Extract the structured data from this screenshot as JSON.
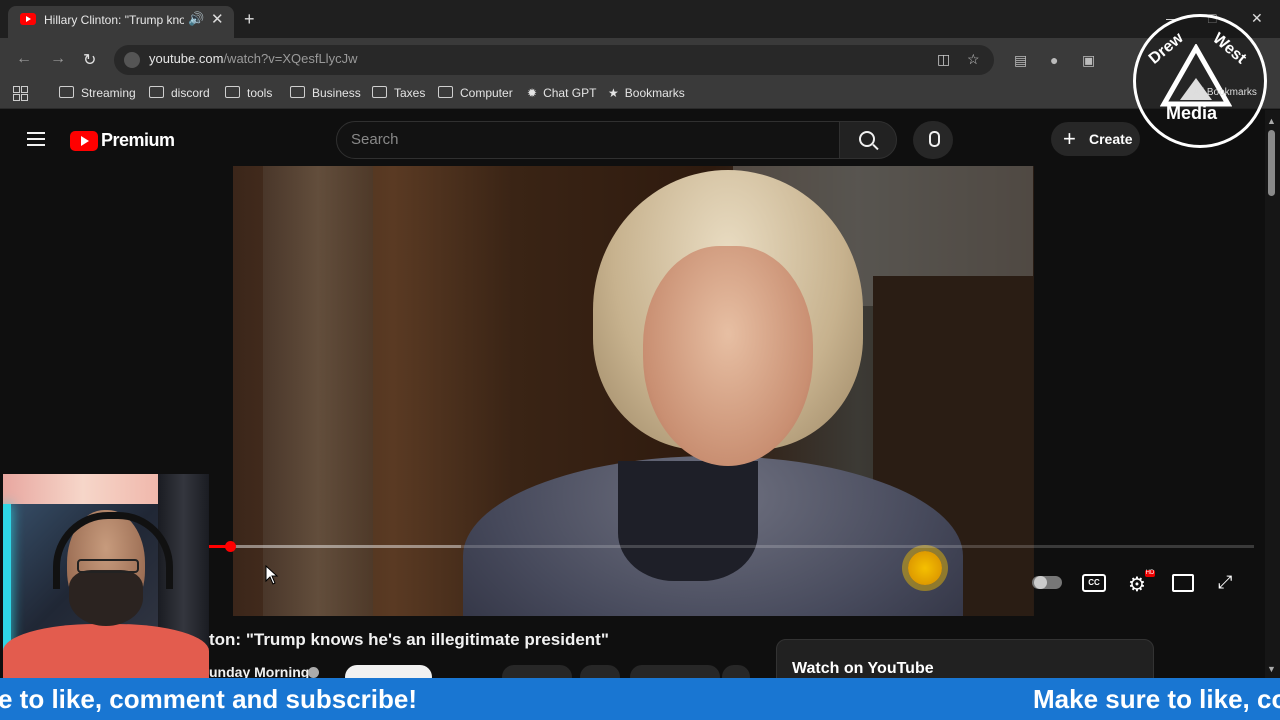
{
  "browser": {
    "tab_title": "Hillary Clinton: \"Trump kno",
    "url_host": "youtube.com",
    "url_path": "/watch?v=XQesfLlycJw",
    "bookmarks": [
      "Streaming",
      "discord",
      "tools",
      "Business",
      "Taxes",
      "Computer",
      "Chat GPT",
      "Bookmarks"
    ]
  },
  "youtube": {
    "brand": "Premium",
    "search_placeholder": "Search",
    "create_label": "Create",
    "video_title": "ton: \"Trump knows he's an illegitimate president\"",
    "channel_name": "unday Morning",
    "watch_on_youtube": "Watch on YouTube",
    "progress_fraction": 0.02
  },
  "overlay": {
    "logo_text": "Media",
    "logo_drew": "Drew",
    "logo_west": "West",
    "logo_all_bookmarks": "All Bookmarks",
    "ticker_left": "e to like, comment and subscribe!",
    "ticker_right": "Make sure to like, cor"
  },
  "colors": {
    "youtube_red": "#ff0000",
    "ticker_blue": "#1976d2"
  }
}
